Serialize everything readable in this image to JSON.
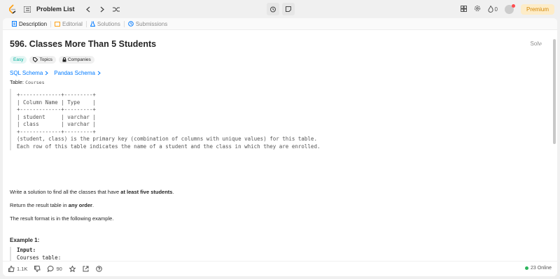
{
  "topbar": {
    "problem_list": "Problem List",
    "streak_count": "0",
    "premium": "Premium"
  },
  "tabs": [
    {
      "label": "Description"
    },
    {
      "label": "Editorial"
    },
    {
      "label": "Solutions"
    },
    {
      "label": "Submissions"
    }
  ],
  "problem": {
    "title": "596. Classes More Than 5 Students",
    "solved": "Solved",
    "difficulty": "Easy",
    "topics": "Topics",
    "companies": "Companies",
    "sql_schema": "SQL Schema",
    "pandas_schema": "Pandas Schema",
    "table_label": "Table:",
    "table_name": "Courses",
    "schema_text": "+-------------+---------+\n| Column Name | Type    |\n+-------------+---------+\n| student     | varchar |\n| class       | varchar |\n+-------------+---------+\n(student, class) is the primary key (combination of columns with unique values) for this table.\nEach row of this table indicates the name of a student and the class in which they are enrolled.",
    "p1_before": "Write a solution to find all the classes that have ",
    "p1_bold": "at least five students",
    "p1_after": ".",
    "p2_before": "Return the result table in ",
    "p2_bold": "any order",
    "p2_after": ".",
    "p3": "The result format is in the following example.",
    "example_title": "Example 1:",
    "input_label": "Input:",
    "example_text": "Courses table:\n+---------+----------+\n| student | class    |"
  },
  "footer": {
    "likes": "1.1K",
    "comments": "90",
    "online": "23 Online"
  },
  "colors": {
    "accent": "#007aff",
    "easy": "#00af9b",
    "premium": "#d48806",
    "online": "#2db55d"
  }
}
